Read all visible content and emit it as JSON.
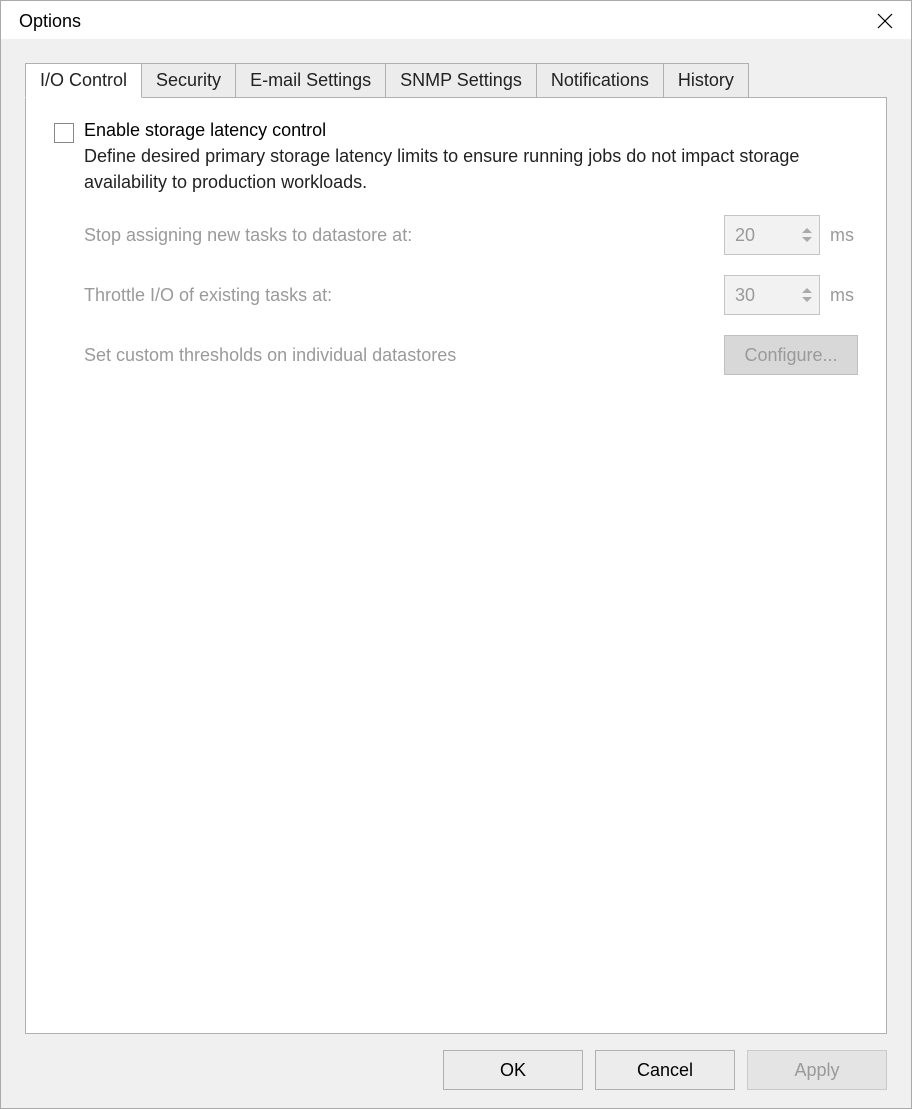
{
  "window": {
    "title": "Options"
  },
  "tabs": [
    {
      "label": "I/O Control",
      "active": true
    },
    {
      "label": "Security",
      "active": false
    },
    {
      "label": "E-mail Settings",
      "active": false
    },
    {
      "label": "SNMP Settings",
      "active": false
    },
    {
      "label": "Notifications",
      "active": false
    },
    {
      "label": "History",
      "active": false
    }
  ],
  "panel": {
    "checkbox_label": "Enable storage latency control",
    "checkbox_desc": "Define desired primary storage latency limits to ensure running jobs do not impact storage availability to production workloads.",
    "checkbox_checked": false,
    "settings": {
      "stop_label": "Stop assigning new tasks to datastore at:",
      "stop_value": "20",
      "stop_unit": "ms",
      "throttle_label": "Throttle I/O of existing tasks at:",
      "throttle_value": "30",
      "throttle_unit": "ms",
      "custom_label": "Set custom thresholds on individual datastores",
      "configure_label": "Configure..."
    }
  },
  "footer": {
    "ok": "OK",
    "cancel": "Cancel",
    "apply": "Apply"
  }
}
